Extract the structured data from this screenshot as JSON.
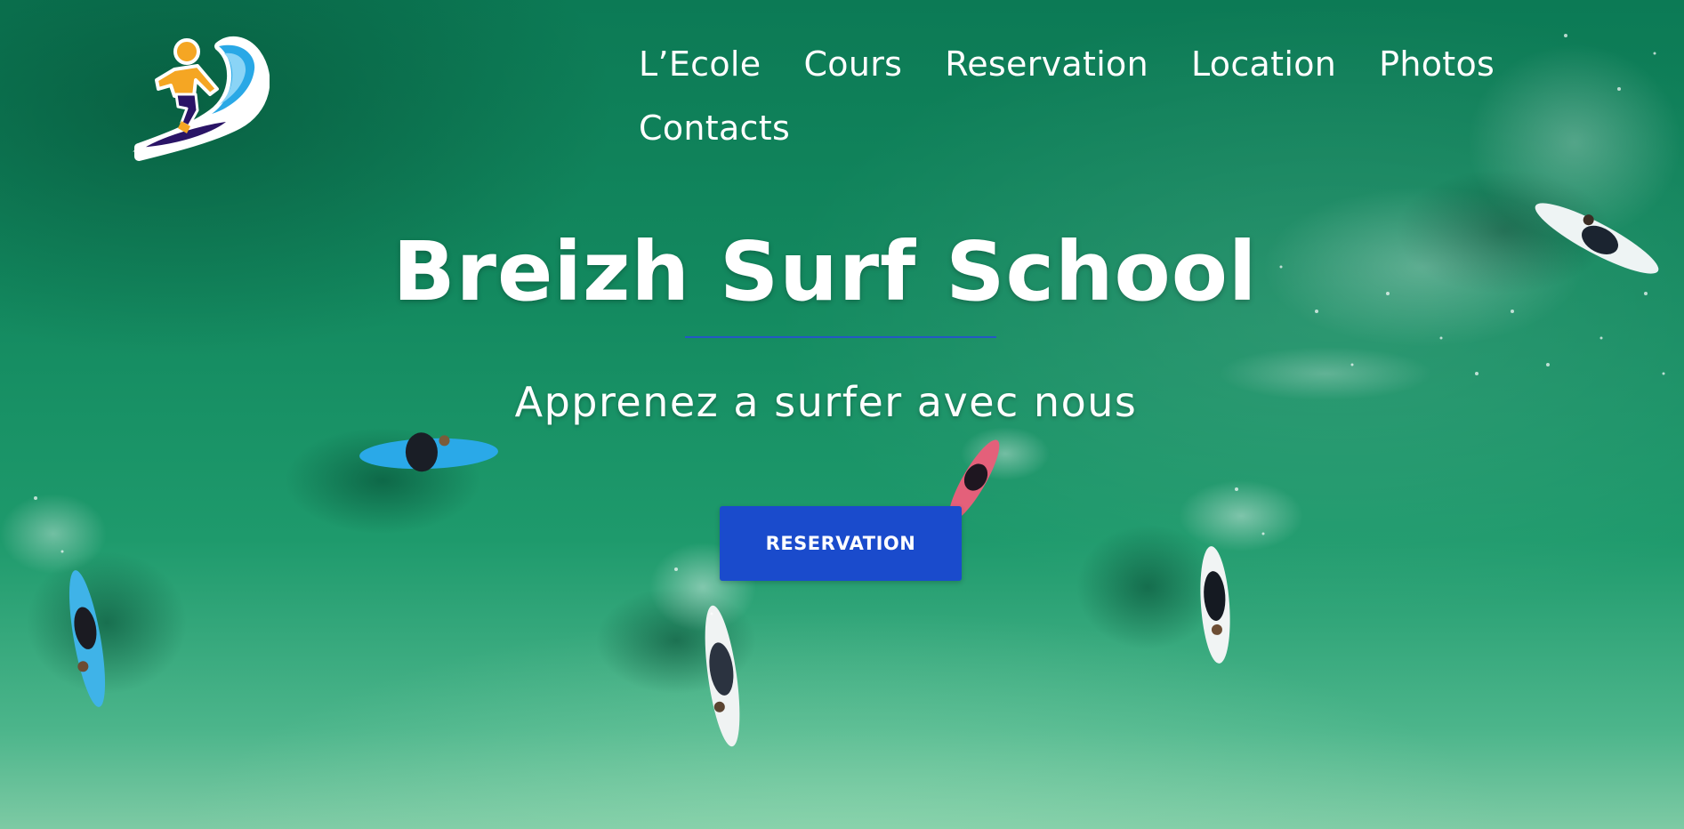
{
  "logo": {
    "icon": "surfer-wave-icon",
    "colors": {
      "wave": "#29a8e6",
      "board": "#2a1466",
      "surfer": "#f5a623"
    }
  },
  "nav": {
    "items": [
      {
        "label": "L’Ecole"
      },
      {
        "label": "Cours"
      },
      {
        "label": "Reservation"
      },
      {
        "label": "Location"
      },
      {
        "label": "Photos"
      },
      {
        "label": "Contacts"
      }
    ]
  },
  "hero": {
    "title": "Breizh Surf School",
    "subtitle": "Apprenez a surfer avec nous",
    "cta_label": "RESERVATION",
    "accent_color": "#1a4bcc",
    "background_description_icon": "aerial-surfers-ocean-photo"
  }
}
